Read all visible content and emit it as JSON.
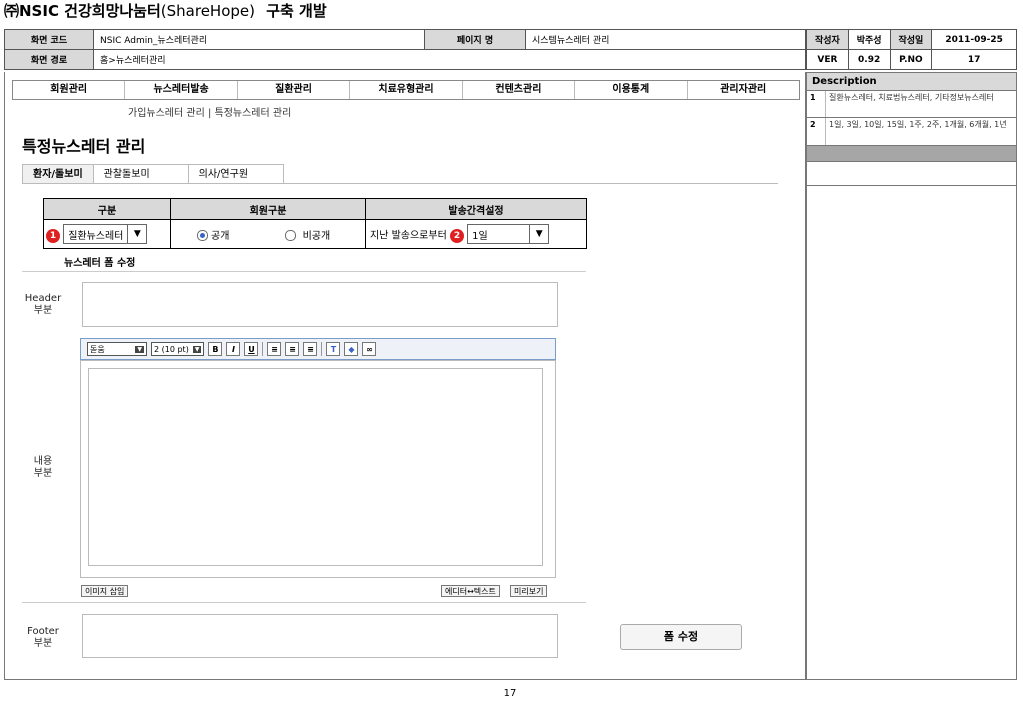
{
  "doc": {
    "title_bold": "㈜NSIC 건강희망나눔터",
    "title_light": "(ShareHope)",
    "title_suffix": "구축 개발"
  },
  "meta": {
    "screen_code_label": "화면 코드",
    "screen_code": "NSIC Admin_뉴스레터관리",
    "page_name_label": "페이지 명",
    "page_name": "시스템뉴스레터 관리",
    "screen_path_label": "화면 경로",
    "screen_path": "홈>뉴스레터관리",
    "author_label": "작성자",
    "author": "박주성",
    "date_label": "작성일",
    "date": "2011-09-25",
    "ver_label": "VER",
    "ver": "0.92",
    "pno_label": "P.NO",
    "pno": "17"
  },
  "description": {
    "title": "Description",
    "items": [
      {
        "num": "1",
        "text": "질환뉴스레터, 치료법뉴스레터, 기타정보뉴스레터"
      },
      {
        "num": "2",
        "text": "1일, 3일, 10일, 15일, 1주, 2주, 1개월, 6개월, 1년"
      }
    ]
  },
  "menu": {
    "items": [
      "회원관리",
      "뉴스레터발송",
      "질환관리",
      "치료유형관리",
      "컨텐츠관리",
      "이용통계",
      "관리자관리"
    ]
  },
  "sub_links": "가입뉴스레터 관리 | 특정뉴스레터 관리",
  "page_title": "특정뉴스레터 관리",
  "tabs": [
    "환자/돌보미",
    "관찰돌보미",
    "의사/연구원"
  ],
  "filter": {
    "col1": "구분",
    "col2": "회원구분",
    "col3": "발송간격설정",
    "category_value": "질환뉴스레터",
    "badge1": "1",
    "radio_public": "공개",
    "radio_private": "비공개",
    "interval_prefix": "지난 발송으로부터",
    "badge2": "2",
    "interval_value": "1일"
  },
  "form": {
    "section_title": "뉴스레터 폼 수정",
    "header_label_1": "Header",
    "header_label_2": "부분",
    "body_label_1": "내용",
    "body_label_2": "부분",
    "footer_label_1": "Footer",
    "footer_label_2": "부분",
    "font_family": "돋움",
    "font_size": "2 (10 pt)",
    "insert_image": "이미지 삽입",
    "editor_toggle": "에디터↔텍스트",
    "preview": "미리보기",
    "submit": "폼 수정"
  },
  "page_number": "17"
}
